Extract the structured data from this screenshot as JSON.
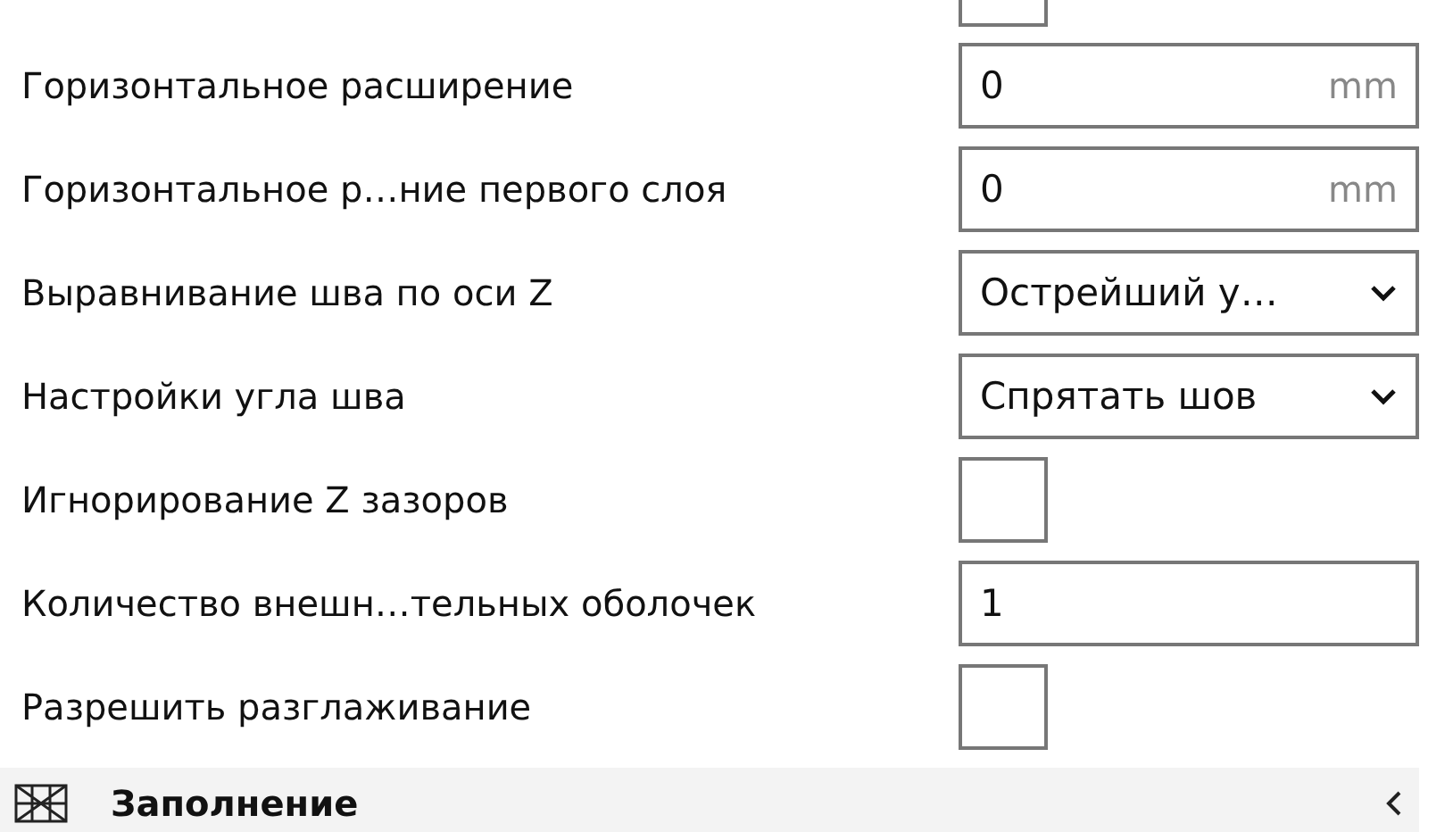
{
  "top_checkbox": {
    "checked": false
  },
  "settings": [
    {
      "kind": "number",
      "label": "Горизонтальное расширение",
      "value": "0",
      "unit": "mm"
    },
    {
      "kind": "number",
      "label": "Горизонтальное р…ние первого слоя",
      "value": "0",
      "unit": "mm"
    },
    {
      "kind": "select",
      "label": "Выравнивание шва по оси Z",
      "value": "Острейший у…"
    },
    {
      "kind": "select",
      "label": "Настройки угла шва",
      "value": "Спрятать шов"
    },
    {
      "kind": "checkbox",
      "label": "Игнорирование Z зазоров",
      "checked": false
    },
    {
      "kind": "text",
      "label": "Количество внешн…тельных оболочек",
      "value": "1"
    },
    {
      "kind": "checkbox",
      "label": "Разрешить разглаживание",
      "checked": false
    }
  ],
  "section": {
    "title": "Заполнение",
    "expanded": false
  }
}
